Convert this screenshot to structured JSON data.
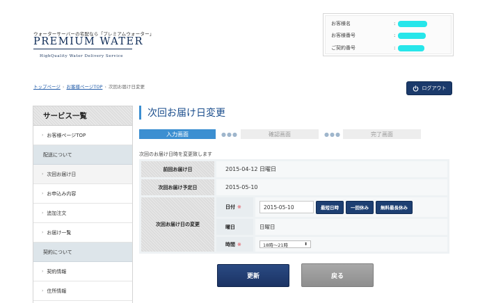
{
  "header": {
    "tagline": "ウォーターサーバーの宅配なら「プレミアムウォーター」",
    "logo": "PREMIUM WATER",
    "logo_sub": "HighQuality  Water  Delivery  Service"
  },
  "customer_info": {
    "rows": [
      {
        "label": "お客様名",
        "colon": ":"
      },
      {
        "label": "お客様番号",
        "colon": ":"
      },
      {
        "label": "ご契約番号",
        "colon": ":"
      }
    ],
    "redaction_color": "#27e6ea"
  },
  "breadcrumb": {
    "items": [
      "トップページ",
      "お客様ページTOP",
      "次回お届け日変更"
    ],
    "sep": "›"
  },
  "logout": {
    "label": "ログアウト",
    "icon": "power-icon"
  },
  "sidebar": {
    "title": "サービス一覧",
    "top_link": "お客様ページTOP",
    "section1": "配送について",
    "section1_items": [
      "次回お届け日",
      "お申込み内容",
      "追加注文",
      "お届け一覧"
    ],
    "section2": "契約について",
    "section2_items": [
      "契約情報",
      "住所情報"
    ],
    "arrow": "›"
  },
  "main": {
    "title": "次回お届け日変更",
    "steps": [
      "入力画面",
      "確認画面",
      "完了画面"
    ],
    "step_dots": "●●●",
    "description": "次回のお届け日時を変更致します",
    "rows": {
      "prev_label": "前回お届け日",
      "prev_value": "2015-04-12 日曜日",
      "next_label": "次回お届け予定日",
      "next_value": "2015-05-10",
      "change_label": "次回お届け日の変更"
    },
    "fields": {
      "date_label": "日付",
      "required_mark": "※",
      "date_value": "2015-05-10",
      "btn_shortest": "最短日時",
      "btn_skip_once": "一回休み",
      "btn_free_long": "無料最長休み",
      "weekday_label": "曜日",
      "weekday_value": "日曜日",
      "time_label": "時間",
      "time_value": "18時〜21時",
      "select_arrow": "⬍"
    },
    "update_label": "更新",
    "back_label": "戻る"
  },
  "colors": {
    "accent": "#3c8fd1",
    "navy": "#1b3a6b",
    "required": "#e0404a"
  }
}
